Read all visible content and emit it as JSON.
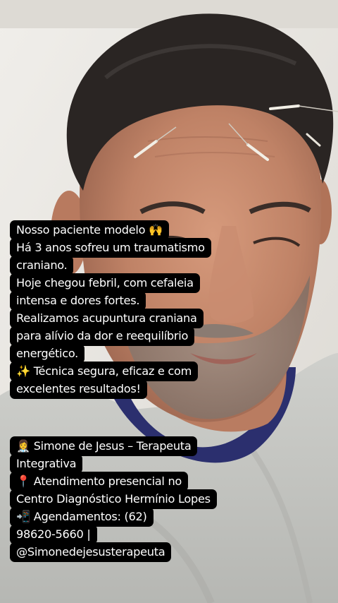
{
  "caption": {
    "block_1": [
      "Nosso paciente modelo 🙌",
      "Há 3 anos sofreu um traumatismo",
      "craniano.",
      "Hoje chegou febril, com cefaleia",
      "intensa e dores fortes.",
      "Realizamos acupuntura craniana",
      "para alívio da dor e reequilíbrio",
      "energético.",
      "✨ Técnica segura, eficaz e com",
      "excelentes resultados!"
    ],
    "block_2": [
      "👩‍⚕️ Simone de Jesus – Terapeuta",
      "Integrativa",
      "📍 Atendimento presencial no",
      "Centro Diagnóstico Hermínio Lopes",
      "📲 Agendamentos: (62)",
      "98620-5660 |",
      "@Simonedejesusterapeuta"
    ]
  },
  "colors": {
    "caption_bg": "#000000",
    "caption_text": "#ffffff",
    "shirt": "#c9cac6",
    "collar": "#2b2f6e",
    "skin": "#c58a6e",
    "hair": "#2a2523",
    "wall": "#e9e7e2"
  }
}
